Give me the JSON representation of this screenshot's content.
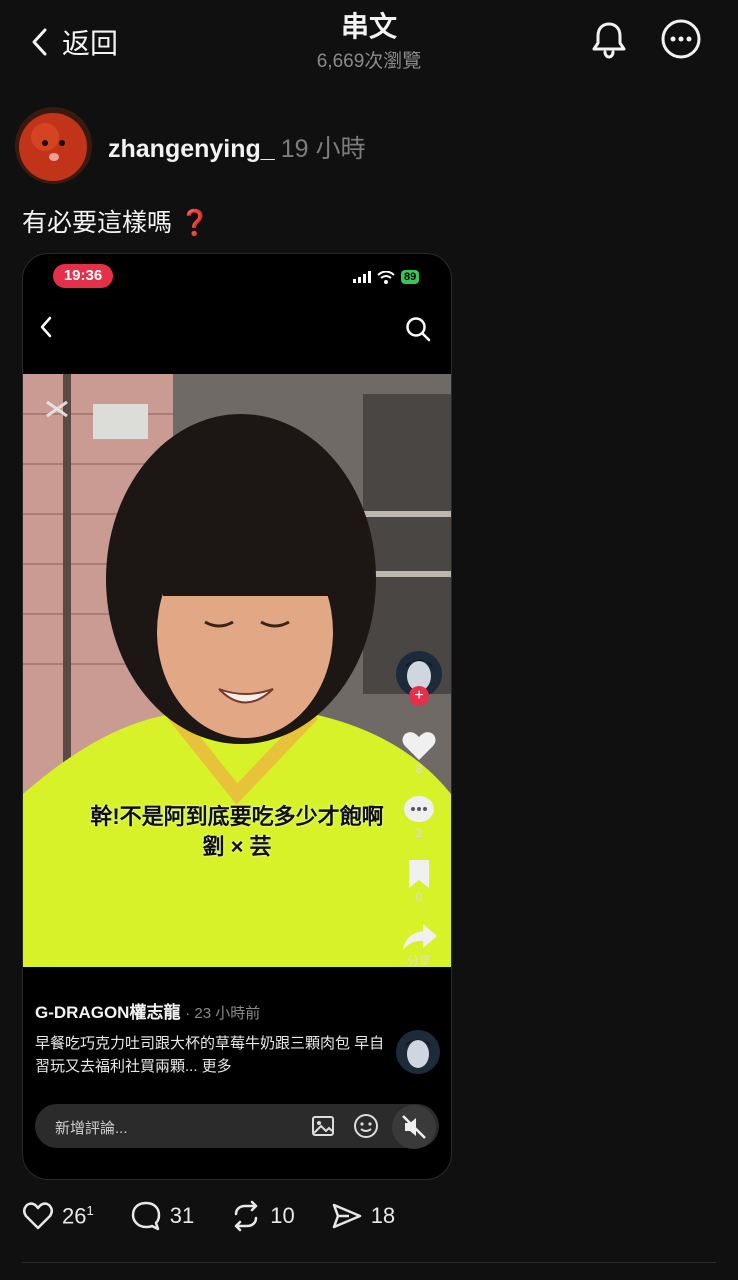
{
  "header": {
    "back_label": "返回",
    "title": "串文",
    "views": "6,669次瀏覽"
  },
  "post": {
    "username": "zhangenying_",
    "time": "19 小時",
    "caption": "有必要這樣嗎 ❓"
  },
  "screenshot": {
    "status_time": "19:36",
    "battery": "89",
    "subtitle_line1": "幹!不是阿到底要吃多少才飽啊",
    "subtitle_line2": "劉 × 芸",
    "like_count": "8",
    "comment_count": "2",
    "save_count": "0",
    "share_label": "分享",
    "video_author": "G-DRAGON權志龍",
    "video_time": "· 23 小時前",
    "video_desc": "早餐吃巧克力吐司跟大杯的草莓牛奶跟三顆肉包 早自習玩又去福利社買兩顆... 更多",
    "comment_placeholder": "新增評論..."
  },
  "actions": {
    "likes": "26",
    "likes_sup": "1",
    "comments": "31",
    "reposts": "10",
    "shares": "18"
  },
  "colors": {
    "background": "#101010",
    "status_red": "#e53049",
    "battery_green": "#34c759",
    "video_shirt": "#d8f22a"
  }
}
